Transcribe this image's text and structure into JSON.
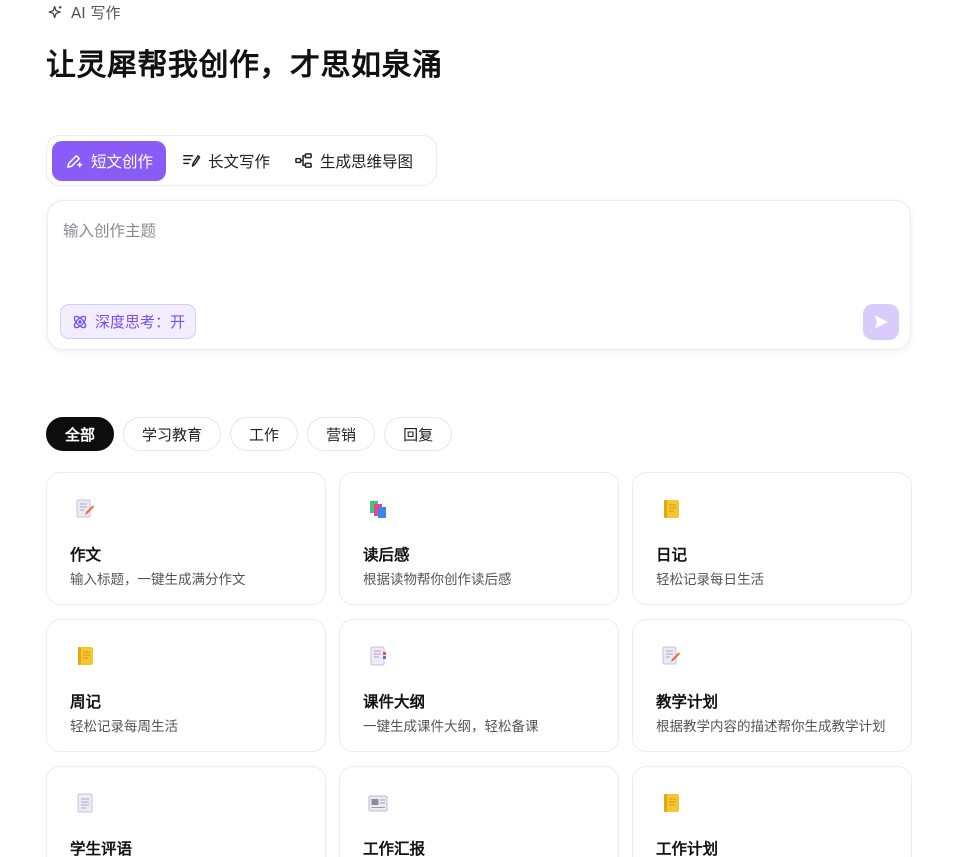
{
  "breadcrumb": {
    "label": "AI 写作",
    "icon": "sparkle-icon"
  },
  "headline": "让灵犀帮我创作，才思如泉涌",
  "mode_tabs": [
    {
      "label": "短文创作",
      "icon": "pen-sparkle-icon",
      "active": true
    },
    {
      "label": "长文写作",
      "icon": "long-text-icon",
      "active": false
    },
    {
      "label": "生成思维导图",
      "icon": "mindmap-icon",
      "active": false
    }
  ],
  "composer": {
    "placeholder": "输入创作主题",
    "value": "",
    "deep_think_label": "深度思考：开",
    "deep_think_icon": "atom-icon",
    "send_icon": "send-icon"
  },
  "filters": [
    {
      "label": "全部",
      "active": true
    },
    {
      "label": "学习教育",
      "active": false
    },
    {
      "label": "工作",
      "active": false
    },
    {
      "label": "营销",
      "active": false
    },
    {
      "label": "回复",
      "active": false
    }
  ],
  "cards": [
    {
      "title": "作文",
      "desc": "输入标题，一键生成满分作文",
      "icon": "memo-icon"
    },
    {
      "title": "读后感",
      "desc": "根据读物帮你创作读后感",
      "icon": "books-icon"
    },
    {
      "title": "日记",
      "desc": "轻松记录每日生活",
      "icon": "notebook-icon"
    },
    {
      "title": "周记",
      "desc": "轻松记录每周生活",
      "icon": "notebook-icon"
    },
    {
      "title": "课件大纲",
      "desc": "一键生成课件大纲，轻松备课",
      "icon": "ledger-icon"
    },
    {
      "title": "教学计划",
      "desc": "根据教学内容的描述帮你生成教学计划",
      "icon": "memo-icon"
    },
    {
      "title": "学生评语",
      "desc": "",
      "icon": "page-icon"
    },
    {
      "title": "工作汇报",
      "desc": "",
      "icon": "newspaper-icon"
    },
    {
      "title": "工作计划",
      "desc": "",
      "icon": "notebook-icon"
    }
  ],
  "colors": {
    "accent": "#8a5cf6",
    "accent_soft": "#f3eeff",
    "send_disabled": "#d9ccfc",
    "chip_active": "#0d0d0d"
  }
}
